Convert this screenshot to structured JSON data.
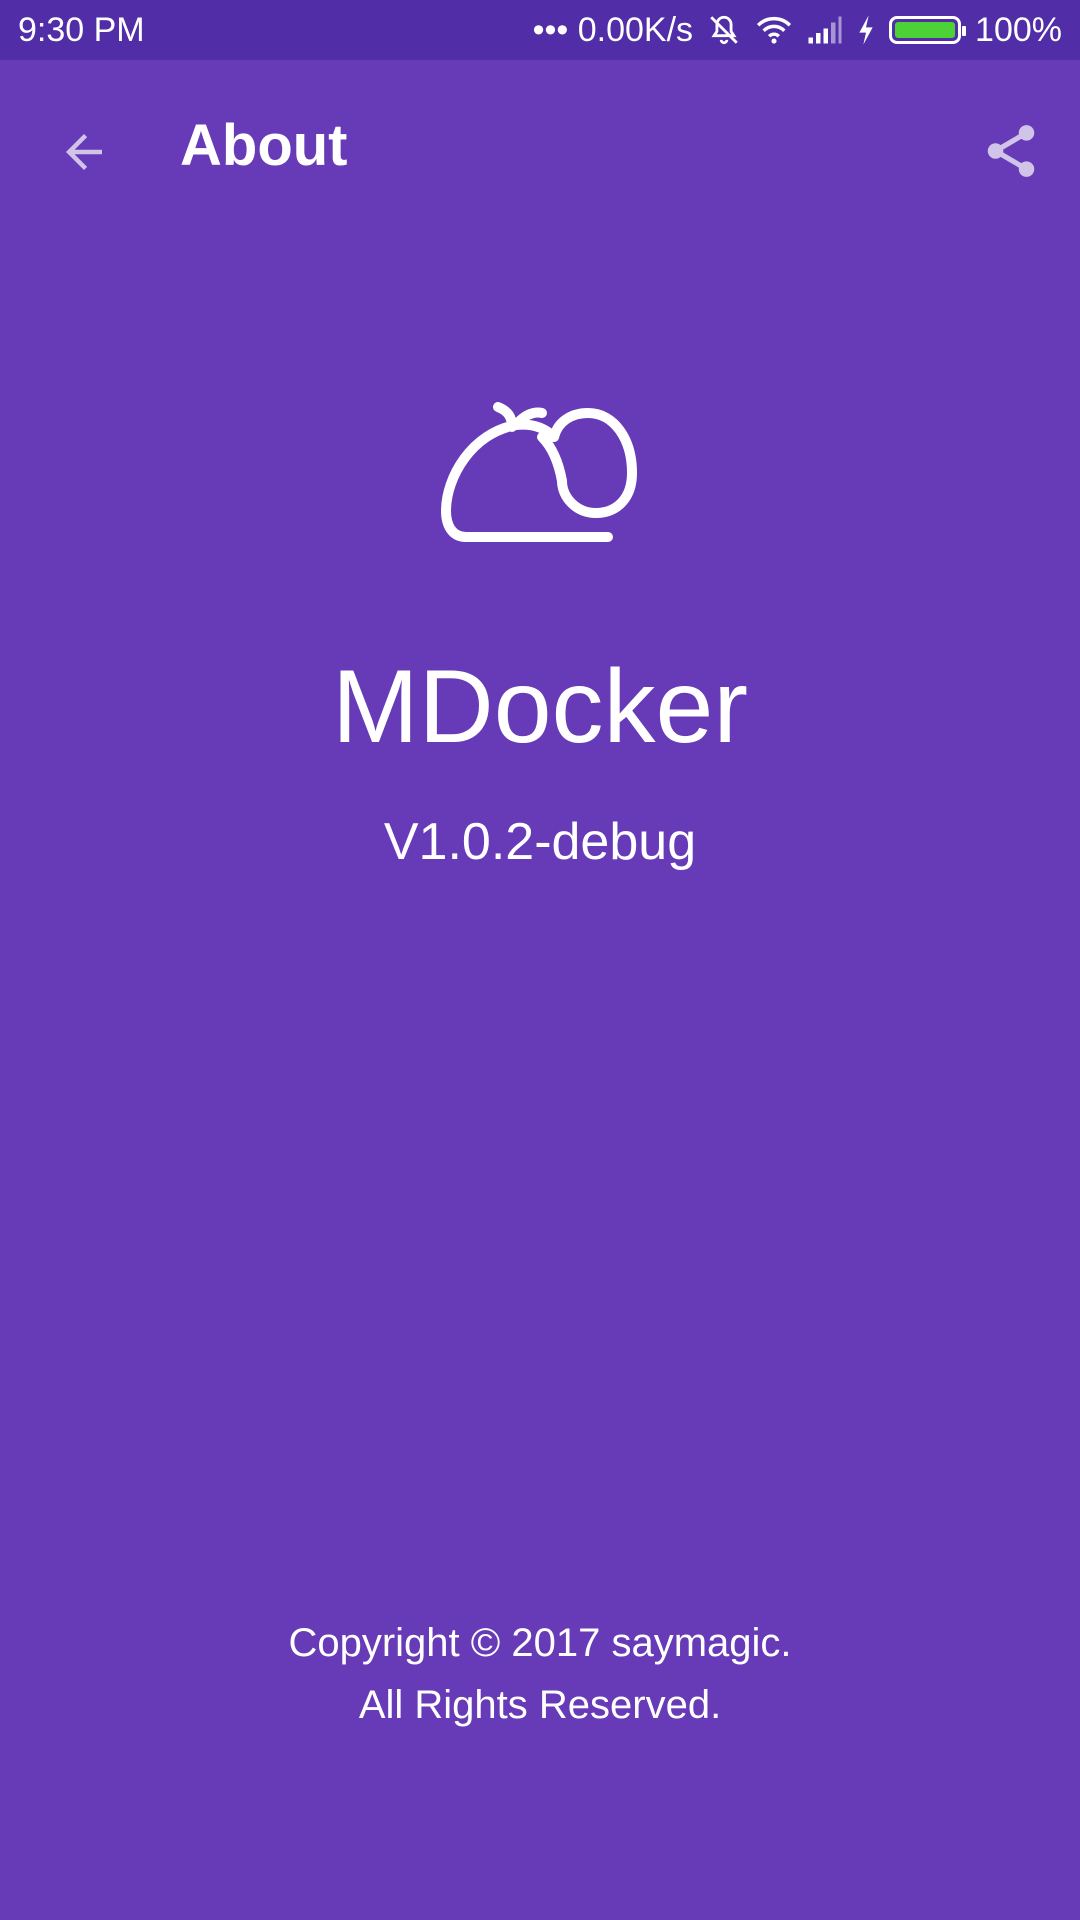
{
  "status_bar": {
    "time": "9:30  PM",
    "network_speed": "••• 0.00K/s",
    "battery_percent": "100%",
    "icons": [
      "mute-icon",
      "wifi-icon",
      "signal-icon",
      "charging-icon",
      "battery-icon"
    ],
    "battery_level": 1.0,
    "battery_color": "#4cd137"
  },
  "toolbar": {
    "title": "About",
    "back_icon": "arrow-back-icon",
    "share_icon": "share-icon"
  },
  "app": {
    "logo_icon": "cloud-logo-icon",
    "name": "MDocker",
    "version": "V1.0.2-debug"
  },
  "footer": {
    "copyright_line1": "Copyright © 2017 saymagic.",
    "copyright_line2": "All Rights Reserved."
  },
  "colors": {
    "background": "#673ab7",
    "status_bar": "#512da8",
    "text": "#ffffff",
    "icon_muted": "#d1c4e9"
  }
}
